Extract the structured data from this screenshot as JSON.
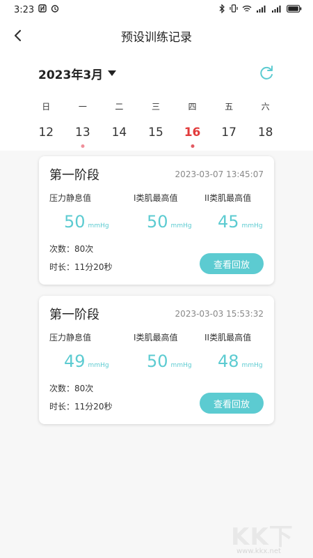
{
  "status_bar": {
    "time": "3:23",
    "battery": "89"
  },
  "nav": {
    "title": "预设训练记录"
  },
  "calendar": {
    "month": "2023年3月",
    "weekdays": [
      "日",
      "一",
      "二",
      "三",
      "四",
      "五",
      "六"
    ],
    "dates": [
      {
        "day": "12",
        "has_record": false,
        "selected": false
      },
      {
        "day": "13",
        "has_record": true,
        "selected": false
      },
      {
        "day": "14",
        "has_record": false,
        "selected": false
      },
      {
        "day": "15",
        "has_record": false,
        "selected": false
      },
      {
        "day": "16",
        "has_record": true,
        "selected": true
      },
      {
        "day": "17",
        "has_record": false,
        "selected": false
      },
      {
        "day": "18",
        "has_record": false,
        "selected": false
      }
    ]
  },
  "metric_labels": {
    "rest": "压力静息值",
    "type1": "I类肌最高值",
    "type2": "II类肌最高值",
    "unit": "mmHg"
  },
  "records": [
    {
      "stage": "第一阶段",
      "time": "2023-03-07 13:45:07",
      "rest_value": "50",
      "type1_value": "50",
      "type2_value": "45",
      "count": "次数：80次",
      "duration": "时长：11分20秒",
      "replay_label": "查看回放"
    },
    {
      "stage": "第一阶段",
      "time": "2023-03-03 15:53:32",
      "rest_value": "49",
      "type1_value": "50",
      "type2_value": "48",
      "count": "次数：80次",
      "duration": "时长：11分20秒",
      "replay_label": "查看回放"
    }
  ],
  "watermark": {
    "brand": "KK下载",
    "url": "www.kkx.net"
  },
  "colors": {
    "accent": "#5ccbd1",
    "selected_date": "#e23b3b",
    "record_dot": "#f0909b"
  }
}
